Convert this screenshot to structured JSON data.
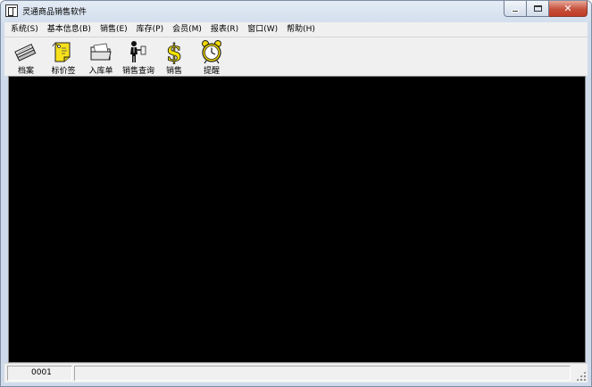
{
  "window": {
    "title": "灵通商品销售软件",
    "controls": {
      "minimize": "minimize",
      "maximize": "maximize",
      "close": "close"
    }
  },
  "menu": [
    {
      "id": "system",
      "label": "系统(S)"
    },
    {
      "id": "basic-info",
      "label": "基本信息(B)"
    },
    {
      "id": "sales",
      "label": "销售(E)"
    },
    {
      "id": "inventory",
      "label": "库存(P)"
    },
    {
      "id": "member",
      "label": "会员(M)"
    },
    {
      "id": "reports",
      "label": "报表(R)"
    },
    {
      "id": "window",
      "label": "窗口(W)"
    },
    {
      "id": "help",
      "label": "帮助(H)"
    }
  ],
  "toolbar": [
    {
      "id": "archive",
      "label": "档案",
      "icon": "archive-icon"
    },
    {
      "id": "price-tag",
      "label": "标价签",
      "icon": "price-tag-icon"
    },
    {
      "id": "stock-in",
      "label": "入库单",
      "icon": "folder-icon"
    },
    {
      "id": "sales-query",
      "label": "销售查询",
      "icon": "person-query-icon"
    },
    {
      "id": "sale",
      "label": "销售",
      "icon": "dollar-icon"
    },
    {
      "id": "reminder",
      "label": "提醒",
      "icon": "alarm-clock-icon"
    }
  ],
  "status": {
    "code": "0001",
    "message": ""
  },
  "colors": {
    "workspace": "#000000",
    "chrome": "#f0f0f0",
    "titlebar": "#d3dfee",
    "close": "#c13b24"
  }
}
